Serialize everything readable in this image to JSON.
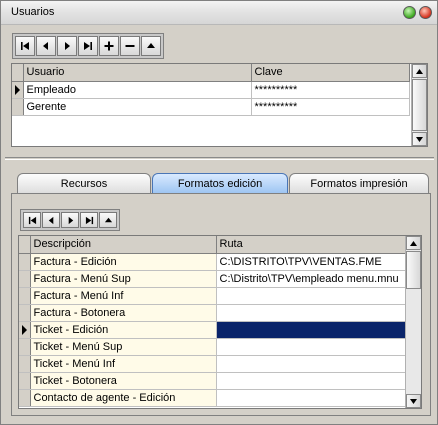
{
  "window": {
    "title": "Usuarios"
  },
  "users_grid": {
    "columns": [
      "Usuario",
      "Clave"
    ],
    "rows": [
      {
        "usuario": "Empleado",
        "clave": "**********"
      },
      {
        "usuario": "Gerente",
        "clave": "**********"
      }
    ],
    "current_row": 0
  },
  "tabs": {
    "items": [
      {
        "label": "Recursos"
      },
      {
        "label": "Formatos edición"
      },
      {
        "label": "Formatos impresión"
      }
    ],
    "active": 1
  },
  "formats_grid": {
    "columns": [
      "Descripción",
      "Ruta"
    ],
    "rows": [
      {
        "descripcion": "Factura - Edición",
        "ruta": "C:\\DISTRITO\\TPV\\VENTAS.FME"
      },
      {
        "descripcion": "Factura - Menú Sup",
        "ruta": "C:\\Distrito\\TPV\\empleado menu.mnu"
      },
      {
        "descripcion": "Factura - Menú Inf",
        "ruta": ""
      },
      {
        "descripcion": "Factura - Botonera",
        "ruta": ""
      },
      {
        "descripcion": "Ticket - Edición",
        "ruta": ""
      },
      {
        "descripcion": "Ticket - Menú Sup",
        "ruta": ""
      },
      {
        "descripcion": "Ticket - Menú Inf",
        "ruta": ""
      },
      {
        "descripcion": "Ticket - Botonera",
        "ruta": ""
      },
      {
        "descripcion": "Contacto de agente - Edición",
        "ruta": ""
      }
    ],
    "current_row": 4
  },
  "icons": {
    "first": "first-record-icon",
    "prev": "previous-record-icon",
    "next": "next-record-icon",
    "last": "last-record-icon",
    "add": "add-record-icon",
    "delete": "delete-record-icon",
    "up": "move-up-icon"
  },
  "colors": {
    "selection": "#0a246a",
    "active_tab": "#98c1f1"
  }
}
